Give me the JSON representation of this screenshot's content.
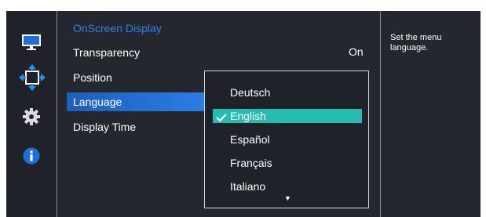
{
  "menu": {
    "title": "OnScreen Display",
    "items": [
      {
        "label": "Transparency",
        "value": "On"
      },
      {
        "label": "Position"
      },
      {
        "label": "Language"
      },
      {
        "label": "Display Time"
      }
    ],
    "selected_index": 2
  },
  "language_dropdown": {
    "options": [
      "Deutsch",
      "English",
      "Español",
      "Français",
      "Italiano"
    ],
    "selected": "English",
    "more_indicator": "▼"
  },
  "help": {
    "text": "Set the menu language."
  },
  "sidebar": {
    "icons": [
      "monitor-icon",
      "position-arrows-icon",
      "gear-icon",
      "info-icon"
    ]
  },
  "colors": {
    "accent_blue": "#2d7ff2",
    "selected_teal": "#27bcb1",
    "active_item": "#1d5fb9"
  }
}
